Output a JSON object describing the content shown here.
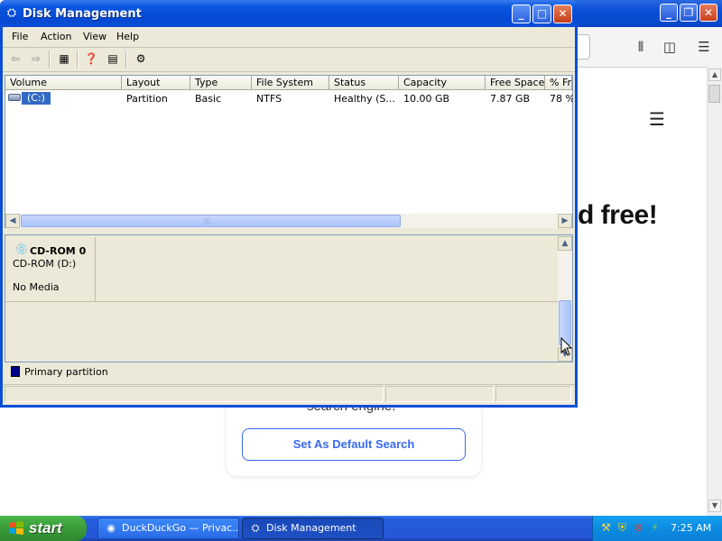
{
  "browser": {
    "headline": "d free!",
    "card_text": "search engine.",
    "default_button": "Set As Default Search",
    "toolbar_icons": [
      "library-icon",
      "sidebar-icon",
      "hamburger-menu-icon"
    ]
  },
  "window": {
    "title": "Disk Management",
    "menu": [
      "File",
      "Action",
      "View",
      "Help"
    ],
    "columns": [
      "Volume",
      "Layout",
      "Type",
      "File System",
      "Status",
      "Capacity",
      "Free Space",
      "% Fr"
    ],
    "rows": [
      {
        "volume": "(C:)",
        "layout": "Partition",
        "type": "Basic",
        "fs": "NTFS",
        "status": "Healthy (S...",
        "capacity": "10.00 GB",
        "free": "7.87 GB",
        "pct": "78 %"
      }
    ],
    "disk": {
      "title": "CD-ROM 0",
      "drive": "CD-ROM (D:)",
      "media": "No Media"
    },
    "legend": "Primary partition",
    "legend_color": "#00008b"
  },
  "taskbar": {
    "start": "start",
    "tasks": [
      "DuckDuckGo — Privac...",
      "Disk Management"
    ],
    "clock": "7:25 AM"
  },
  "colors": {
    "xp_blue": "#0a4fd6",
    "selection": "#316ac5",
    "ddg_blue": "#3969ef"
  }
}
